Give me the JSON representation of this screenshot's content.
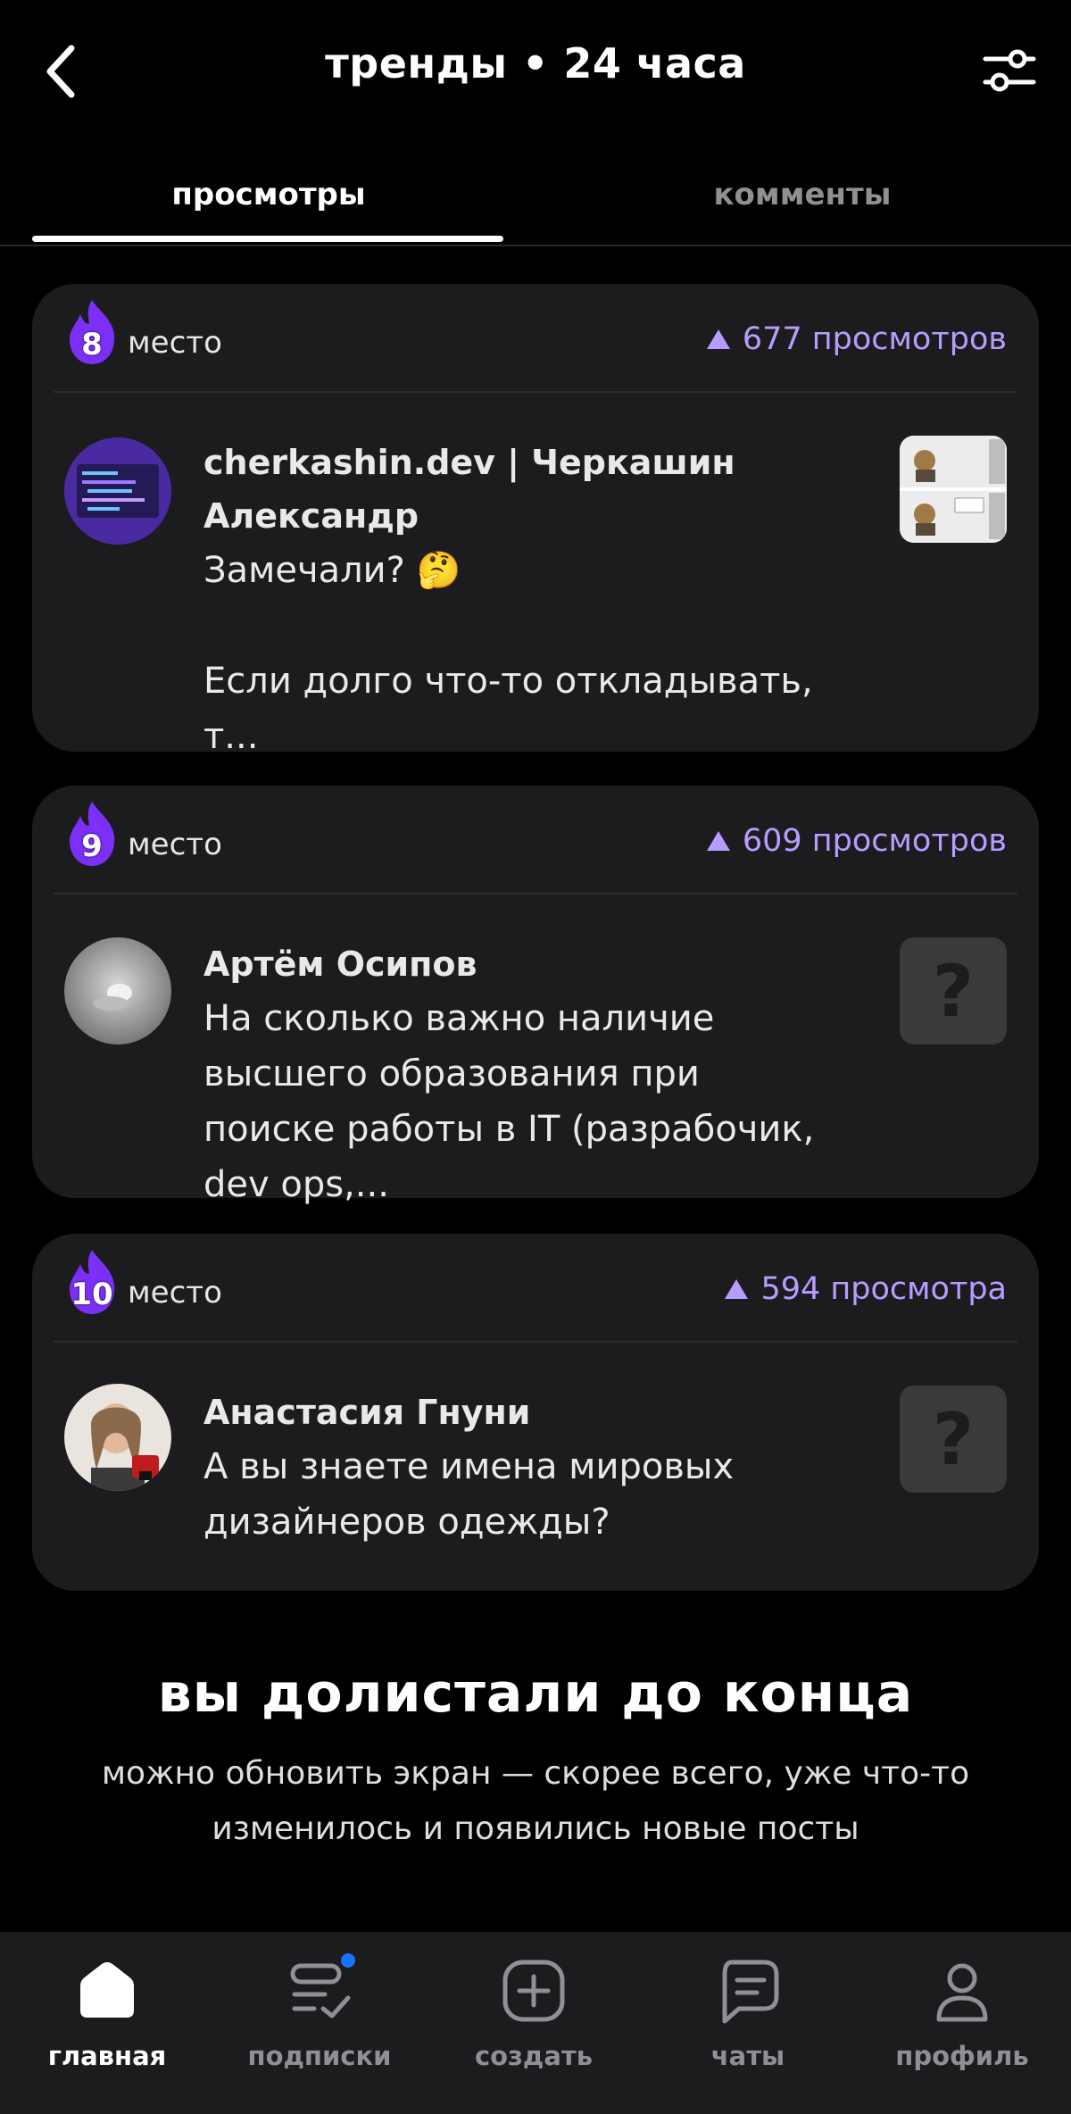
{
  "header": {
    "title": "тренды • 24 часа"
  },
  "tabs": [
    {
      "label": "просмотры",
      "active": true
    },
    {
      "label": "комменты",
      "active": false
    }
  ],
  "posts": [
    {
      "rank": "8",
      "rank_label": "место",
      "views": "677 просмотров",
      "author": "cherkashin.dev | Черкашин Александр",
      "text": "Замечали? 🤔\n\nЕсли долго что-то откладывать, т...",
      "thumbnail": "image"
    },
    {
      "rank": "9",
      "rank_label": "место",
      "views": "609 просмотров",
      "author": "Артём Осипов",
      "text": "На сколько важно наличие высшего образования при поиске работы в IT (разрабочик, dev ops,...",
      "thumbnail": "?"
    },
    {
      "rank": "10",
      "rank_label": "место",
      "views": "594 просмотра",
      "author": "Анастасия Гнуни",
      "text": "А вы знаете имена мировых дизайнеров одежды?",
      "thumbnail": "?"
    }
  ],
  "end": {
    "title": "вы долистали до конца",
    "subtitle": "можно обновить экран — скорее всего, уже что-то изменилось и появились новые посты"
  },
  "nav": [
    {
      "label": "главная",
      "icon": "home-icon",
      "active": true
    },
    {
      "label": "подписки",
      "icon": "subscriptions-icon",
      "active": false,
      "badge": true
    },
    {
      "label": "создать",
      "icon": "create-icon",
      "active": false
    },
    {
      "label": "чаты",
      "icon": "chat-icon",
      "active": false
    },
    {
      "label": "профиль",
      "icon": "profile-icon",
      "active": false
    }
  ],
  "colors": {
    "accent": "#b89cff",
    "flame": "#7b2ff7",
    "card": "#1c1c1e",
    "badge": "#1a73ff"
  }
}
